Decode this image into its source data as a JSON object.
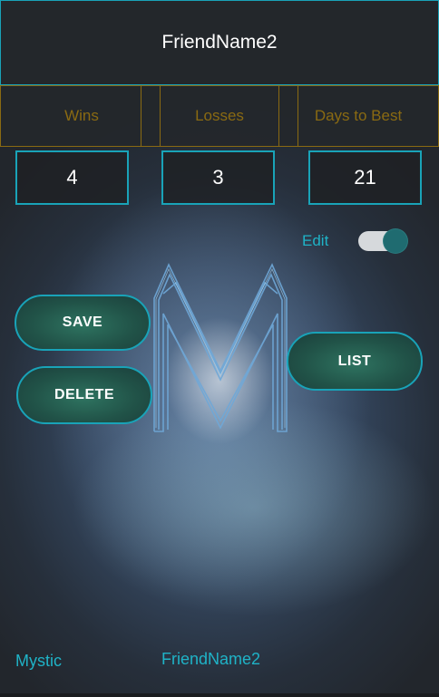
{
  "header": {
    "title": "FriendName2"
  },
  "stats": {
    "labels": [
      "Wins",
      "Losses",
      "Days to Best"
    ],
    "values": [
      "4",
      "3",
      "21"
    ]
  },
  "edit": {
    "label": "Edit",
    "enabled": true
  },
  "buttons": {
    "save": "SAVE",
    "delete": "DELETE",
    "list": "LIST"
  },
  "footer": {
    "left": "Mystic",
    "center": "FriendName2"
  },
  "colors": {
    "accent": "#19a3b8",
    "label_gold": "#8a6a12",
    "button_fill": "#215348"
  },
  "icons": {
    "logo": "m-logo-icon",
    "toggle": "edit-toggle"
  }
}
